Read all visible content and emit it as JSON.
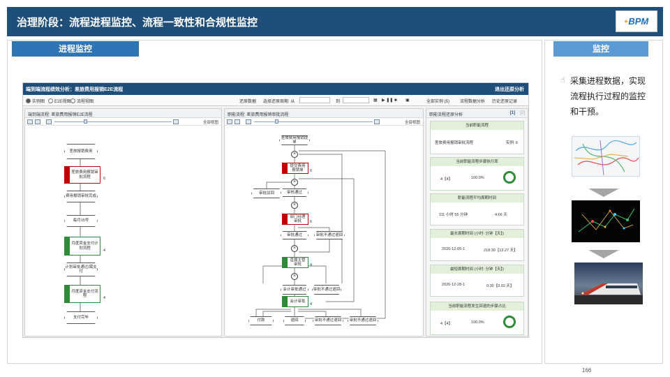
{
  "header": {
    "title": "治理阶段：流程进程监控、流程一致性和合规性监控",
    "logo_text": "BPM"
  },
  "left_panel": {
    "tag": "进程监控"
  },
  "right_panel": {
    "tag": "监控",
    "bullet_icon": "pointing-hand-icon",
    "text": "采集进程数据，实现流程执行过程的监控和干预。"
  },
  "app": {
    "title": "端到端流程绩效分析：差旅费用报销E2E流程",
    "exit_label": "退出还原分析",
    "view_options": [
      "实例图",
      "E2E视图",
      "流程视图"
    ],
    "selected_view": "实例图",
    "toolbar": {
      "restore_data": "还原数据",
      "select_restore_period": "选择还原周期: 从",
      "to": "到",
      "all_instances": "全部实例 (5)",
      "process_data_analysis": "流程数据分析",
      "history_restore_record": "历史还原记录"
    },
    "panes": {
      "left_title": "端到端流程: 差旅费用报销E2E流程",
      "left_mode": "全部视图",
      "mid_title": "职能流程: 差旅费用报销审批流程",
      "mid_mode": "全部视图",
      "right_title": "职能流程还原分析",
      "right_pager": "[1]",
      "right_pager_next": "[2]"
    },
    "left_flow": {
      "nodes": [
        "差旅报销费用",
        "差旅费用报销审批流程",
        "费用报销审批完成",
        "每月15号",
        "月度资金支付计划流程",
        "计划审批通过/需支付",
        "月度资金支付流程",
        "支付完毕"
      ],
      "counts": [
        "6",
        "4",
        "4"
      ]
    },
    "mid_flow": {
      "nodes": [
        "差旅费用报销提单",
        "提交费用报销单",
        "直属主管审批",
        "审核通过",
        "部门经理审批",
        "审批驳回",
        "审批不通过退回",
        "财务经理审批",
        "会计审批",
        "审批通过",
        "会计审批通过",
        "审批不通过退回",
        "审批不通过退回",
        "付款",
        "退回",
        "审批不通过退回"
      ],
      "counts": [
        "6",
        "6",
        "4",
        "4"
      ]
    },
    "stats": [
      {
        "header": "当前职能流程",
        "left": "差旅费用报销审批流程",
        "right": "实例: 6"
      },
      {
        "header": "当前职能流程步骤执行率",
        "left": "4【4】",
        "right": "100.0%",
        "ring": true
      },
      {
        "header": "职能流程平均周期时间",
        "left": "111 小时 55 分钟",
        "right": "4.66 天"
      },
      {
        "header": "最长周期时间 (小时: 分钟【天】)",
        "left": "2020-12-05-1",
        "right": "218:30【13.27 天】"
      },
      {
        "header": "最短周期时间 (小时: 分钟【天】)",
        "left": "2020-12-28-1",
        "right": "0:30【0.02 天】"
      },
      {
        "header": "当前职能流程发生回退的步骤占比",
        "left": "4【4】",
        "right": "100.0%",
        "ring": true
      }
    ]
  },
  "page_number": "166",
  "colors": {
    "header_bg": "#1f4e79",
    "tag_left": "#2e75b6",
    "tag_right": "#5b9bd5",
    "task_red": "#c00000",
    "task_green": "#2e8b3a",
    "card_header": "#e2efd9"
  }
}
